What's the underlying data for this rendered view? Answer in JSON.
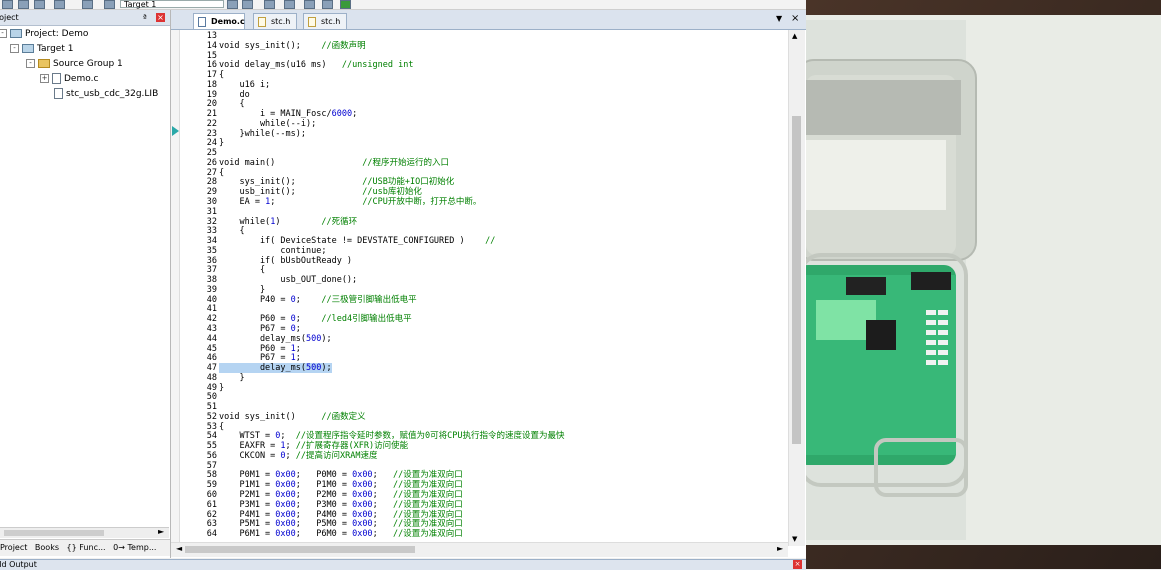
{
  "toolbar": {
    "target_label": "Target 1"
  },
  "project_panel": {
    "title": "roject",
    "pin": "ª",
    "tree": [
      {
        "label": "Project: Demo",
        "expander": "-"
      },
      {
        "label": "Target 1",
        "expander": "-"
      },
      {
        "label": "Source Group 1",
        "expander": "-"
      },
      {
        "label": "Demo.c",
        "expander": "+"
      },
      {
        "label": "stc_usb_cdc_32g.LIB",
        "expander": ""
      }
    ],
    "bottom_tabs": [
      "Project",
      "Books",
      "{} Func...",
      "0→ Temp..."
    ]
  },
  "editor": {
    "tabs": [
      {
        "label": "Demo.c"
      },
      {
        "label": "stc.h"
      },
      {
        "label": "stc.h"
      }
    ],
    "menu_arrow": "▼",
    "close": "×",
    "lines": [
      {
        "n": "13",
        "text": ""
      },
      {
        "n": "14",
        "text": "void sys_init();    //函数声明"
      },
      {
        "n": "15",
        "text": ""
      },
      {
        "n": "16",
        "text": "void delay_ms(u16 ms)   //unsigned int"
      },
      {
        "n": "17",
        "text": "{"
      },
      {
        "n": "18",
        "text": "    u16 i;"
      },
      {
        "n": "19",
        "text": "    do"
      },
      {
        "n": "20",
        "text": "    {"
      },
      {
        "n": "21",
        "text": "        i = MAIN_Fosc/6000;"
      },
      {
        "n": "22",
        "text": "        while(--i);"
      },
      {
        "n": "23",
        "text": "    }while(--ms);"
      },
      {
        "n": "24",
        "text": "}"
      },
      {
        "n": "25",
        "text": ""
      },
      {
        "n": "26",
        "text": "void main()                 //程序开始运行的入口"
      },
      {
        "n": "27",
        "text": "{"
      },
      {
        "n": "28",
        "text": "    sys_init();             //USB功能+IO口初始化"
      },
      {
        "n": "29",
        "text": "    usb_init();             //usb库初始化"
      },
      {
        "n": "30",
        "text": "    EA = 1;                 //CPU开放中断，打开总中断。"
      },
      {
        "n": "31",
        "text": ""
      },
      {
        "n": "32",
        "text": "    while(1)        //死循环"
      },
      {
        "n": "33",
        "text": "    {"
      },
      {
        "n": "34",
        "text": "        if( DeviceState != DEVSTATE_CONFIGURED )    //"
      },
      {
        "n": "35",
        "text": "            continue;"
      },
      {
        "n": "36",
        "text": "        if( bUsbOutReady )"
      },
      {
        "n": "37",
        "text": "        {"
      },
      {
        "n": "38",
        "text": "            usb_OUT_done();"
      },
      {
        "n": "39",
        "text": "        }"
      },
      {
        "n": "40",
        "text": "        P40 = 0;    //三极管引脚输出低电平"
      },
      {
        "n": "41",
        "text": ""
      },
      {
        "n": "42",
        "text": "        P60 = 0;    //led4引脚输出低电平"
      },
      {
        "n": "43",
        "text": "        P67 = 0;"
      },
      {
        "n": "44",
        "text": "        delay_ms(500);"
      },
      {
        "n": "45",
        "text": "        P60 = 1;"
      },
      {
        "n": "46",
        "text": "        P67 = 1;"
      },
      {
        "n": "47",
        "text": "        delay_ms(500);"
      },
      {
        "n": "48",
        "text": "    }"
      },
      {
        "n": "49",
        "text": "}"
      },
      {
        "n": "50",
        "text": ""
      },
      {
        "n": "51",
        "text": ""
      },
      {
        "n": "52",
        "text": "void sys_init()     //函数定义"
      },
      {
        "n": "53",
        "text": "{"
      },
      {
        "n": "54",
        "text": "    WTST = 0;  //设置程序指令延时参数，赋值为0可将CPU执行指令的速度设置为最快"
      },
      {
        "n": "55",
        "text": "    EAXFR = 1; //扩展寄存器(XFR)访问使能"
      },
      {
        "n": "56",
        "text": "    CKCON = 0; //提高访问XRAM速度"
      },
      {
        "n": "57",
        "text": ""
      },
      {
        "n": "58",
        "text": "    P0M1 = 0x00;   P0M0 = 0x00;   //设置为准双向口"
      },
      {
        "n": "59",
        "text": "    P1M1 = 0x00;   P1M0 = 0x00;   //设置为准双向口"
      },
      {
        "n": "60",
        "text": "    P2M1 = 0x00;   P2M0 = 0x00;   //设置为准双向口"
      },
      {
        "n": "61",
        "text": "    P3M1 = 0x00;   P3M0 = 0x00;   //设置为准双向口"
      },
      {
        "n": "62",
        "text": "    P4M1 = 0x00;   P4M0 = 0x00;   //设置为准双向口"
      },
      {
        "n": "63",
        "text": "    P5M1 = 0x00;   P5M0 = 0x00;   //设置为准双向口"
      },
      {
        "n": "64",
        "text": "    P6M1 = 0x00;   P6M0 = 0x00;   //设置为准双向口"
      }
    ],
    "highlight_line": "47"
  },
  "build_output": {
    "title": "ild Output",
    "close": "×"
  },
  "colors": {
    "comment": "#008000",
    "number": "#0000d0",
    "highlight": "#e4f4ea",
    "selection": "#b5d4f2"
  }
}
